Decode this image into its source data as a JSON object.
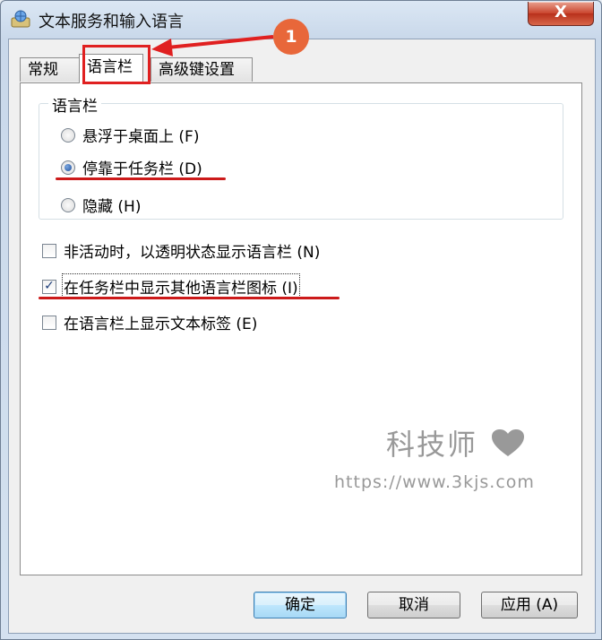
{
  "window": {
    "title": "文本服务和输入语言",
    "close_label": "X"
  },
  "tabs": [
    {
      "label": "常规"
    },
    {
      "label": "语言栏"
    },
    {
      "label": "高级键设置"
    }
  ],
  "language_bar_group": {
    "legend": "语言栏",
    "options": [
      {
        "label": "悬浮于桌面上 (F)",
        "checked": false
      },
      {
        "label": "停靠于任务栏 (D)",
        "checked": true
      },
      {
        "label": "隐藏 (H)",
        "checked": false
      }
    ]
  },
  "checkboxes": [
    {
      "label": "非活动时，以透明状态显示语言栏 (N)",
      "checked": false
    },
    {
      "label": "在任务栏中显示其他语言栏图标 (I)",
      "checked": true
    },
    {
      "label": "在语言栏上显示文本标签 (E)",
      "checked": false
    }
  ],
  "buttons": {
    "ok": "确定",
    "cancel": "取消",
    "apply": "应用 (A)"
  },
  "annotation": {
    "step_number": "1",
    "accent_color": "#e02020",
    "badge_color": "#e8673a"
  },
  "watermark": {
    "title": "科技师",
    "url": "https://www.3kjs.com"
  }
}
